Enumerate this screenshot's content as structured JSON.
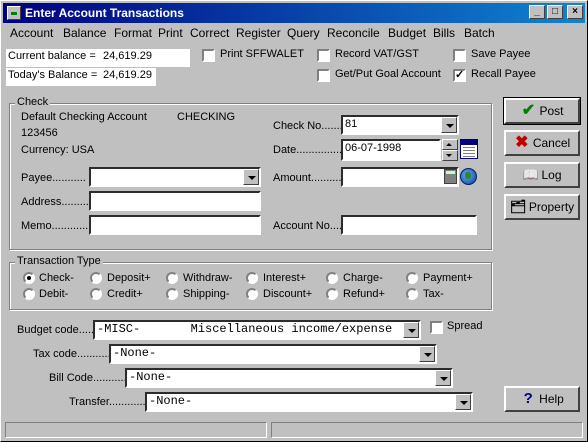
{
  "window": {
    "title": "Enter Account Transactions"
  },
  "menu": [
    "Account",
    "Balance",
    "Format",
    "Print",
    "Correct",
    "Register",
    "Query",
    "Reconcile",
    "Budget",
    "Bills",
    "Batch"
  ],
  "balances": {
    "current_label": "Current balance =",
    "current_value": "24,619.29",
    "today_label": "Today's Balance =",
    "today_value": "24,619.29"
  },
  "options": {
    "print_sffwalet": "Print SFFWALET",
    "record_vat": "Record VAT/GST",
    "goal_account": "Get/Put Goal Account",
    "save_payee": "Save Payee",
    "recall_payee": "Recall Payee",
    "recall_payee_checked": "✓"
  },
  "check": {
    "group_title": "Check",
    "account_name": "Default Checking Account",
    "account_type": "CHECKING",
    "account_number": "123456",
    "currency": "Currency: USA",
    "payee_label": "Payee...........",
    "payee_value": "",
    "address_label": "Address..........",
    "address_value": "",
    "memo_label": "Memo............",
    "memo_value": "",
    "checkno_label": "Check No.......",
    "checkno_value": "81",
    "date_label": "Date...............",
    "date_value": "06-07-1998",
    "amount_label": "Amount..........",
    "amount_value": "",
    "accountno_label": "Account No.....",
    "accountno_value": ""
  },
  "transaction_type": {
    "group_title": "Transaction Type",
    "row1": [
      "Check-",
      "Deposit+",
      "Withdraw-",
      "Interest+",
      "Charge-",
      "Payment+"
    ],
    "row2": [
      "Debit-",
      "Credit+",
      "Shipping-",
      "Discount+",
      "Refund+",
      "Tax-"
    ],
    "selected": "Check-"
  },
  "codes": {
    "budget_label": "Budget code.......",
    "budget_value": "-MISC-       Miscellaneous income/expense",
    "spread_label": "Spread",
    "tax_label": "Tax code...........",
    "tax_value": "-None-",
    "bill_label": "Bill Code............",
    "bill_value": "-None-",
    "transfer_label": "Transfer............",
    "transfer_value": "-None-"
  },
  "buttons": {
    "post": "Post",
    "cancel": "Cancel",
    "log": "Log",
    "property": "Property",
    "help": "Help"
  },
  "colors": {
    "title_bar": "#000080",
    "face": "#c0c0c0",
    "post_check": "#008000",
    "cancel_x": "#c00000"
  }
}
